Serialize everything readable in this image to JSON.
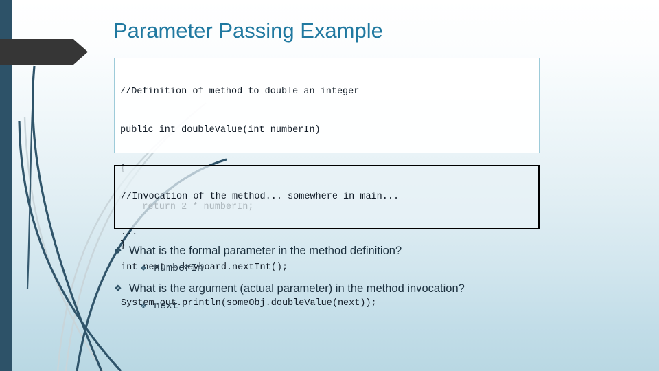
{
  "slide": {
    "title": "Parameter Passing Example",
    "accent_title_color": "#2079a0",
    "left_bar_color": "#2d5268",
    "banner_color": "#363636",
    "background_top_color": "#ffffff",
    "background_bottom_color": "#b9d8e3"
  },
  "code_box_definition": {
    "border_color": "#9dcbd9",
    "lines": [
      "//Definition of method to double an integer",
      "public int doubleValue(int numberIn)",
      "{",
      "    return 2 * numberIn;",
      "}"
    ]
  },
  "code_box_invocation": {
    "border_color": "#000000",
    "lines": [
      "//Invocation of the method... somewhere in main...",
      "...",
      "int next = keyboard.nextInt();",
      "System.out.println(someObj.doubleValue(next));"
    ]
  },
  "bullets": [
    {
      "level": 1,
      "marker": "diamond-bullet",
      "glyph": "❖",
      "text": "What is the formal parameter in the method definition?"
    },
    {
      "level": 2,
      "marker": "diamond-bullet",
      "glyph": "❖",
      "text": "numberIn"
    },
    {
      "level": 1,
      "marker": "diamond-bullet",
      "glyph": "❖",
      "text": "What is the argument (actual parameter) in the method invocation?"
    },
    {
      "level": 2,
      "marker": "diamond-bullet",
      "glyph": "❖",
      "text": "next"
    }
  ]
}
